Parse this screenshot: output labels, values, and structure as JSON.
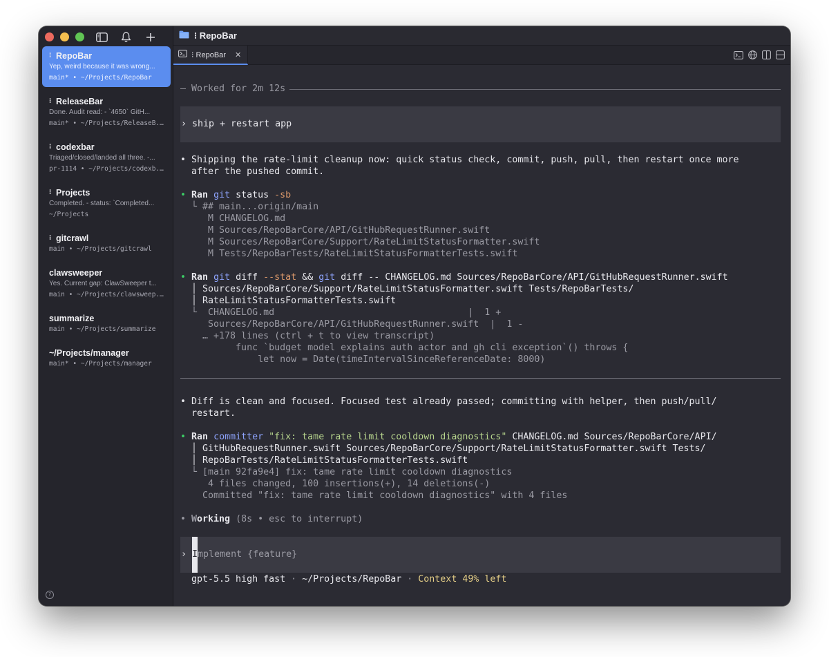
{
  "sidebar": {
    "sessions": [
      {
        "title": "RepoBar",
        "icon": "⁝",
        "preview": "Yep, weird because it was wrong...",
        "meta": "main* • ~/Projects/RepoBar",
        "active": true
      },
      {
        "title": "ReleaseBar",
        "icon": "⁝",
        "preview": "Done. Audit read: - `4650` GitH...",
        "meta": "main* • ~/Projects/ReleaseB..."
      },
      {
        "title": "codexbar",
        "icon": "⁝",
        "preview": "Triaged/closed/landed all three. -...",
        "meta": "pr-1114 • ~/Projects/codexb..."
      },
      {
        "title": "Projects",
        "icon": "⁝",
        "preview": "Completed. - status: `Completed...",
        "meta": "~/Projects"
      },
      {
        "title": "gitcrawl",
        "icon": "⁝",
        "preview": "",
        "meta": "main • ~/Projects/gitcrawl"
      },
      {
        "title": "clawsweeper",
        "icon": "",
        "preview": "Yes. Current gap: ClawSweeper t...",
        "meta": "main • ~/Projects/clawsweep..."
      },
      {
        "title": "summarize",
        "icon": "",
        "preview": "",
        "meta": "main • ~/Projects/summarize"
      },
      {
        "title": "~/Projects/manager",
        "icon": "",
        "preview": "",
        "meta": "main* • ~/Projects/manager"
      }
    ]
  },
  "header": {
    "title": "⁝ RepoBar"
  },
  "tabs": [
    {
      "label": "⁝ RepoBar"
    }
  ],
  "transcript": {
    "worked": "— Worked for 2m 12s",
    "user_prompt": "› ship + restart app",
    "msg1": [
      "• Shipping the rate-limit cleanup now: quick status check, commit, push, pull, then restart once more",
      "  after the pushed commit."
    ],
    "cmd1": {
      "bullet": "• ",
      "ran": "Ran",
      "sp": " ",
      "git": "git",
      "rest": " status ",
      "flag": "-sb",
      "output": [
        "  └ ## main...origin/main",
        "     M CHANGELOG.md",
        "     M Sources/RepoBarCore/API/GitHubRequestRunner.swift",
        "     M Sources/RepoBarCore/Support/RateLimitStatusFormatter.swift",
        "     M Tests/RepoBarTests/RateLimitStatusFormatterTests.swift"
      ]
    },
    "cmd2": {
      "bullet": "• ",
      "ran": "Ran",
      "sp": " ",
      "git1": "git",
      "p1": " diff ",
      "flag": "--stat",
      "p2": " && ",
      "git2": "git",
      "p3": " diff -- CHANGELOG.md Sources/RepoBarCore/API/GitHubRequestRunner.swift",
      "cont": [
        "  │ Sources/RepoBarCore/Support/RateLimitStatusFormatter.swift Tests/RepoBarTests/",
        "  │ RateLimitStatusFormatterTests.swift"
      ],
      "output": [
        "  └  CHANGELOG.md                                   |  1 +",
        "     Sources/RepoBarCore/API/GitHubRequestRunner.swift  |  1 -",
        "    … +178 lines (ctrl + t to view transcript)",
        "          func `budget model explains auth actor and gh cli exception`() throws {",
        "              let now = Date(timeIntervalSinceReferenceDate: 8000)"
      ]
    },
    "msg2": [
      "• Diff is clean and focused. Focused test already passed; committing with helper, then push/pull/",
      "  restart."
    ],
    "cmd3": {
      "bullet": "• ",
      "ran": "Ran",
      "sp": " ",
      "tool": "committer",
      "p1": " ",
      "str": "\"fix: tame rate limit cooldown diagnostics\"",
      "p2": " CHANGELOG.md Sources/RepoBarCore/API/",
      "cont": [
        "  │ GitHubRequestRunner.swift Sources/RepoBarCore/Support/RateLimitStatusFormatter.swift Tests/",
        "  │ RepoBarTests/RateLimitStatusFormatterTests.swift"
      ],
      "output": [
        "  └ [main 92fa9e4] fix: tame rate limit cooldown diagnostics",
        "     4 files changed, 100 insertions(+), 14 deletions(-)",
        "    Committed \"fix: tame rate limit cooldown diagnostics\" with 4 files"
      ]
    },
    "working": {
      "bullet": "• ",
      "w": "W",
      "rest": "orking",
      "hint": " (8s • esc to interrupt)"
    },
    "input": {
      "chevron": "› ",
      "cursor_char": "I",
      "placeholder_rest": "mplement {feature}"
    },
    "status": {
      "model": "  gpt-5.5 high fast",
      "sep1": " · ",
      "path": "~/Projects/RepoBar",
      "sep2": " · ",
      "context": "Context 49% left"
    }
  }
}
